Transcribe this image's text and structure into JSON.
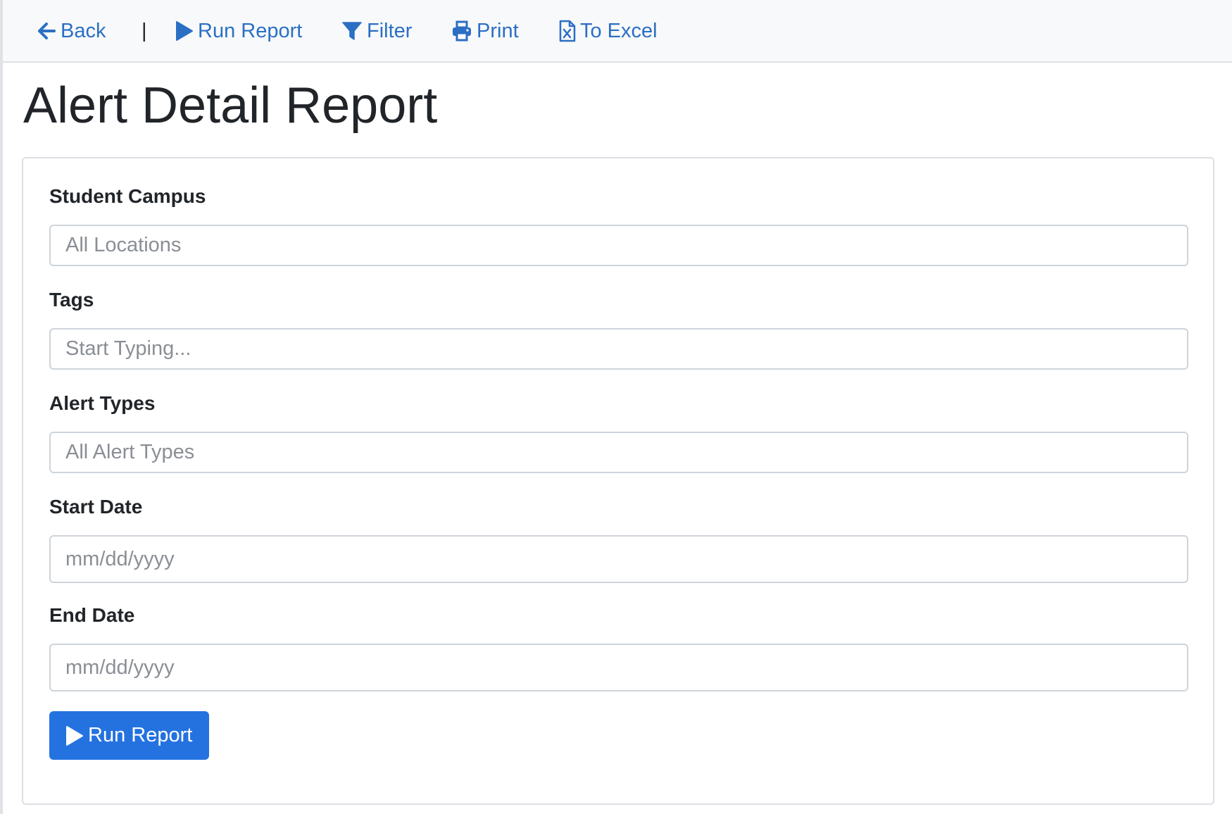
{
  "toolbar": {
    "back_label": "Back",
    "separator": "|",
    "run_report_label": "Run Report",
    "filter_label": "Filter",
    "print_label": "Print",
    "excel_label": "To Excel"
  },
  "page": {
    "title": "Alert Detail Report"
  },
  "form": {
    "campus": {
      "label": "Student Campus",
      "placeholder": "All Locations",
      "value": ""
    },
    "tags": {
      "label": "Tags",
      "placeholder": "Start Typing...",
      "value": ""
    },
    "alert_types": {
      "label": "Alert Types",
      "placeholder": "All Alert Types",
      "value": ""
    },
    "start_date": {
      "label": "Start Date",
      "placeholder": "mm/dd/yyyy",
      "value": ""
    },
    "end_date": {
      "label": "End Date",
      "placeholder": "mm/dd/yyyy",
      "value": ""
    },
    "submit_label": "Run Report"
  },
  "icons": {
    "back": "arrow-left-icon",
    "run": "play-icon",
    "filter": "filter-icon",
    "print": "printer-icon",
    "excel": "file-excel-icon"
  },
  "colors": {
    "link": "#2b6fc4",
    "primary_button": "#2472e0",
    "toolbar_bg": "#f8f9fa"
  }
}
